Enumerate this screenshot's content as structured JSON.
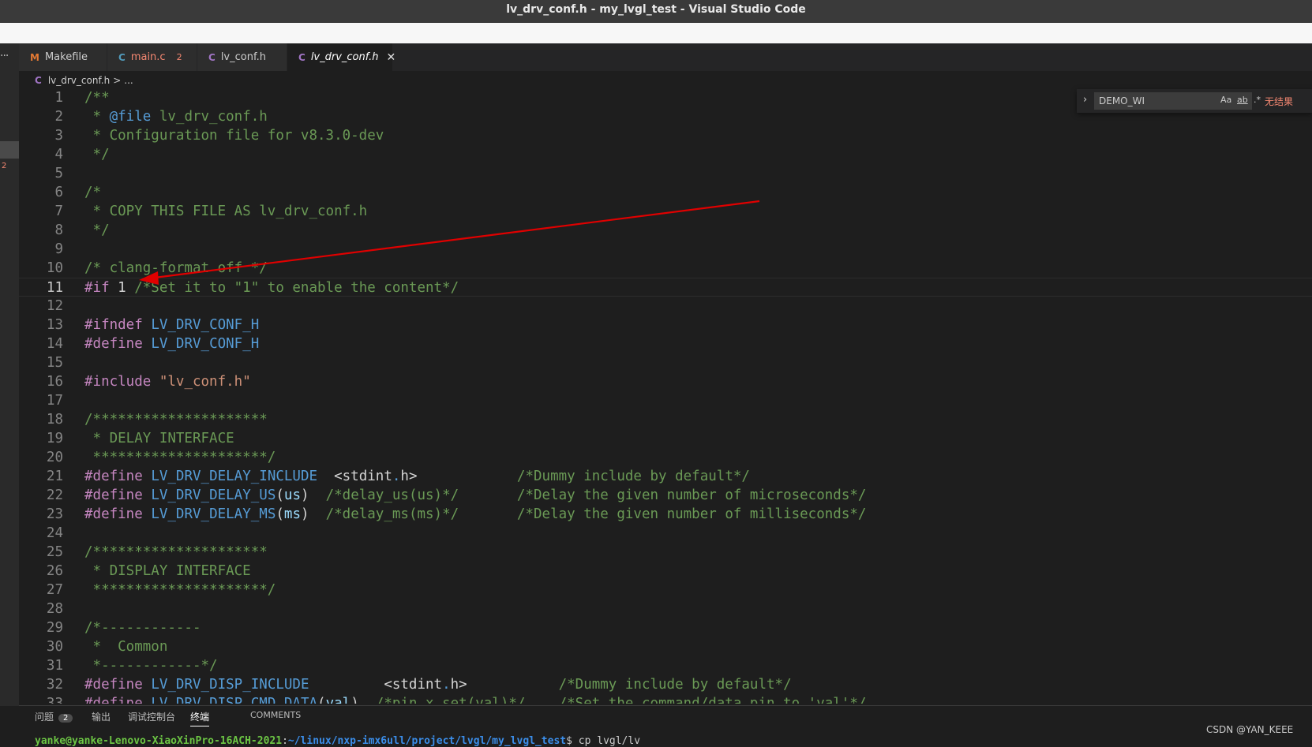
{
  "window": {
    "title": "lv_drv_conf.h - my_lvgl_test - Visual Studio Code"
  },
  "tabs": [
    {
      "icon": "M",
      "label": "Makefile",
      "badge": "",
      "color": "#e37933"
    },
    {
      "icon": "C",
      "label": "main.c",
      "badge": "2",
      "color": "#519aba"
    },
    {
      "icon": "C",
      "label": "lv_conf.h",
      "badge": "",
      "color": "#a074c4"
    },
    {
      "icon": "C",
      "label": "lv_drv_conf.h",
      "badge": "",
      "color": "#a074c4"
    }
  ],
  "left_strip": {
    "ellipsis": "···",
    "problem_count": "2"
  },
  "breadcrumb": {
    "icon": "C",
    "file": "lv_drv_conf.h",
    "sep": ">",
    "rest": "..."
  },
  "find_widget": {
    "query": "DEMO_WI",
    "match_case": "Aa",
    "whole_word": "ab",
    "regex": ".*",
    "result": "无结果"
  },
  "editor": {
    "current_line": 11,
    "lines": [
      {
        "n": "1",
        "t": [
          [
            "c",
            "/**"
          ]
        ]
      },
      {
        "n": "2",
        "t": [
          [
            "c",
            " * "
          ],
          [
            "m",
            "@file"
          ],
          [
            "c",
            " lv_drv_conf.h"
          ]
        ]
      },
      {
        "n": "3",
        "t": [
          [
            "c",
            " * Configuration file for v8.3.0-dev"
          ]
        ]
      },
      {
        "n": "4",
        "t": [
          [
            "c",
            " */"
          ]
        ]
      },
      {
        "n": "5",
        "t": []
      },
      {
        "n": "6",
        "t": [
          [
            "c",
            "/*"
          ]
        ]
      },
      {
        "n": "7",
        "t": [
          [
            "c",
            " * COPY THIS FILE AS lv_drv_conf.h"
          ]
        ]
      },
      {
        "n": "8",
        "t": [
          [
            "c",
            " */"
          ]
        ]
      },
      {
        "n": "9",
        "t": []
      },
      {
        "n": "10",
        "t": [
          [
            "c",
            "/* clang-format off */"
          ]
        ]
      },
      {
        "n": "11",
        "t": [
          [
            "k",
            "#if"
          ],
          [
            "w",
            " 1 "
          ],
          [
            "c",
            "/*Set it to \"1\" to enable the content*/"
          ]
        ]
      },
      {
        "n": "12",
        "t": []
      },
      {
        "n": "13",
        "t": [
          [
            "k",
            "#ifndef"
          ],
          [
            "w",
            " "
          ],
          [
            "m",
            "LV_DRV_CONF_H"
          ]
        ]
      },
      {
        "n": "14",
        "t": [
          [
            "k",
            "#define"
          ],
          [
            "w",
            " "
          ],
          [
            "m",
            "LV_DRV_CONF_H"
          ]
        ]
      },
      {
        "n": "15",
        "t": []
      },
      {
        "n": "16",
        "t": [
          [
            "k",
            "#include"
          ],
          [
            "w",
            " "
          ],
          [
            "s",
            "\"lv_conf.h\""
          ]
        ]
      },
      {
        "n": "17",
        "t": []
      },
      {
        "n": "18",
        "t": [
          [
            "c",
            "/*********************"
          ]
        ]
      },
      {
        "n": "19",
        "t": [
          [
            "c",
            " * DELAY INTERFACE"
          ]
        ]
      },
      {
        "n": "20",
        "t": [
          [
            "c",
            " *********************/"
          ]
        ]
      },
      {
        "n": "21",
        "t": [
          [
            "k",
            "#define"
          ],
          [
            "w",
            " "
          ],
          [
            "m",
            "LV_DRV_DELAY_INCLUDE"
          ],
          [
            "w",
            "  <stdint"
          ],
          [
            "m",
            "."
          ],
          [
            "w",
            "h>            "
          ],
          [
            "c",
            "/*Dummy include by default*/"
          ]
        ]
      },
      {
        "n": "22",
        "t": [
          [
            "k",
            "#define"
          ],
          [
            "w",
            " "
          ],
          [
            "m",
            "LV_DRV_DELAY_US"
          ],
          [
            "w",
            "("
          ],
          [
            "v",
            "us"
          ],
          [
            "w",
            ")  "
          ],
          [
            "c",
            "/*delay_us(us)*/       /*Delay the given number of microseconds*/"
          ]
        ]
      },
      {
        "n": "23",
        "t": [
          [
            "k",
            "#define"
          ],
          [
            "w",
            " "
          ],
          [
            "m",
            "LV_DRV_DELAY_MS"
          ],
          [
            "w",
            "("
          ],
          [
            "v",
            "ms"
          ],
          [
            "w",
            ")  "
          ],
          [
            "c",
            "/*delay_ms(ms)*/       /*Delay the given number of milliseconds*/"
          ]
        ]
      },
      {
        "n": "24",
        "t": []
      },
      {
        "n": "25",
        "t": [
          [
            "c",
            "/*********************"
          ]
        ]
      },
      {
        "n": "26",
        "t": [
          [
            "c",
            " * DISPLAY INTERFACE"
          ]
        ]
      },
      {
        "n": "27",
        "t": [
          [
            "c",
            " *********************/"
          ]
        ]
      },
      {
        "n": "28",
        "t": []
      },
      {
        "n": "29",
        "t": [
          [
            "c",
            "/*------------"
          ]
        ]
      },
      {
        "n": "30",
        "t": [
          [
            "c",
            " *  Common"
          ]
        ]
      },
      {
        "n": "31",
        "t": [
          [
            "c",
            " *------------*/"
          ]
        ]
      },
      {
        "n": "32",
        "t": [
          [
            "k",
            "#define"
          ],
          [
            "w",
            " "
          ],
          [
            "m",
            "LV_DRV_DISP_INCLUDE"
          ],
          [
            "w",
            "         <stdint"
          ],
          [
            "m",
            "."
          ],
          [
            "w",
            "h>           "
          ],
          [
            "c",
            "/*Dummy include by default*/"
          ]
        ]
      },
      {
        "n": "33",
        "t": [
          [
            "k",
            "#define"
          ],
          [
            "w",
            " "
          ],
          [
            "m",
            "LV_DRV_DISP_CMD_DATA"
          ],
          [
            "w",
            "("
          ],
          [
            "v",
            "val"
          ],
          [
            "w",
            ")  "
          ],
          [
            "c",
            "/*pin_x_set(val)*/    /*Set the command/data pin to 'val'*/"
          ]
        ]
      }
    ]
  },
  "panel": {
    "tabs": [
      {
        "label": "问题",
        "badge": "2"
      },
      {
        "label": "输出",
        "badge": ""
      },
      {
        "label": "调试控制台",
        "badge": ""
      },
      {
        "label": "终端",
        "badge": ""
      },
      {
        "label": "COMMENTS",
        "badge": ""
      }
    ],
    "active": "终端"
  },
  "terminal": {
    "user": "yanke@yanke-Lenovo-XiaoXinPro-16ACH-2021",
    "path": "~/linux/nxp-imx6ull/project/lvgl/my_lvgl_test",
    "command": "$ cp lvgl/lv"
  },
  "watermark": "CSDN @YAN_KEEE",
  "colors": {
    "annotation_arrow": "#e00000",
    "comment": "#6a9955",
    "keyword": "#c586c0",
    "macro": "#569cd6"
  }
}
